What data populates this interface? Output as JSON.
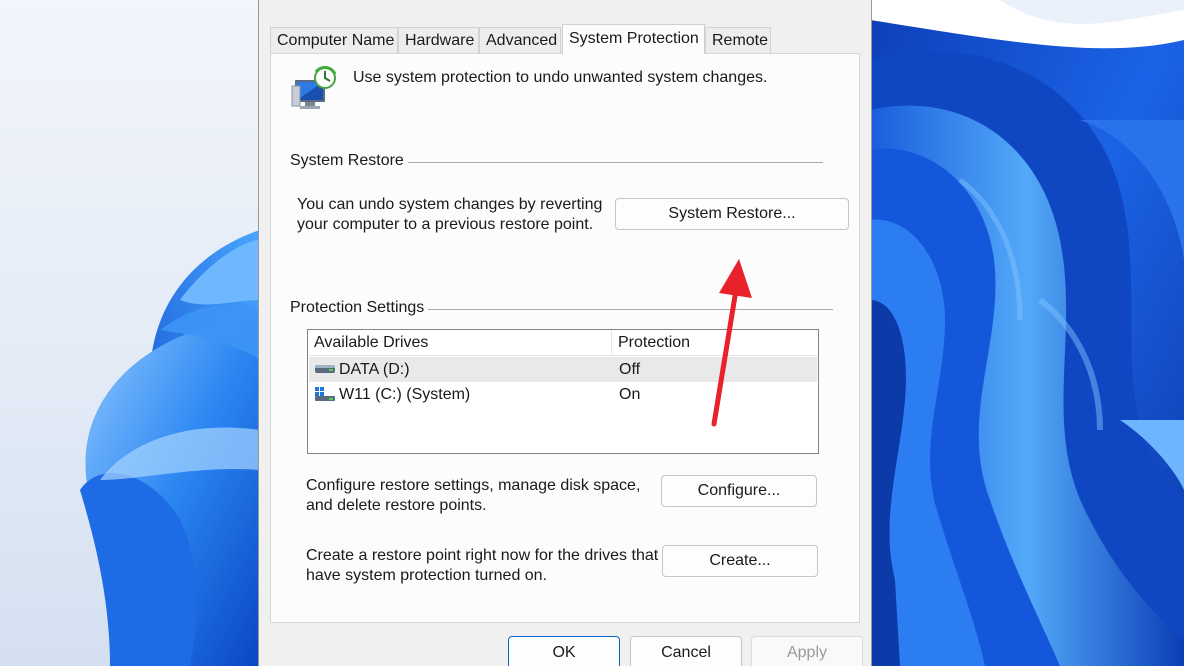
{
  "dialog": {
    "tabs": [
      {
        "label": "Computer Name",
        "active": false
      },
      {
        "label": "Hardware",
        "active": false
      },
      {
        "label": "Advanced",
        "active": false
      },
      {
        "label": "System Protection",
        "active": true
      },
      {
        "label": "Remote",
        "active": false
      }
    ],
    "intro_text": "Use system protection to undo unwanted system changes.",
    "system_restore": {
      "group_title": "System Restore",
      "description_line1": "You can undo system changes by reverting",
      "description_line2": "your computer to a previous restore point.",
      "button_label": "System Restore..."
    },
    "protection_settings": {
      "group_title": "Protection Settings",
      "columns": [
        "Available Drives",
        "Protection"
      ],
      "drives": [
        {
          "name": "DATA (D:)",
          "protection": "Off",
          "icon": "drive-icon"
        },
        {
          "name": "W11 (C:) (System)",
          "protection": "On",
          "icon": "windows-drive-icon"
        }
      ],
      "configure_text_line1": "Configure restore settings, manage disk space,",
      "configure_text_line2": "and delete restore points.",
      "configure_button": "Configure...",
      "create_text_line1": "Create a restore point right now for the drives that",
      "create_text_line2": "have system protection turned on.",
      "create_button": "Create..."
    },
    "footer": {
      "ok": "OK",
      "cancel": "Cancel",
      "apply": "Apply"
    }
  },
  "annotation": {
    "icon": "red-arrow",
    "color": "#e8212a"
  },
  "colors": {
    "wallpaper_blue": "#1456d6",
    "dialog_bg": "#f0f0f0",
    "panel_bg": "#fcfcfc",
    "accent": "#0a64c8"
  }
}
